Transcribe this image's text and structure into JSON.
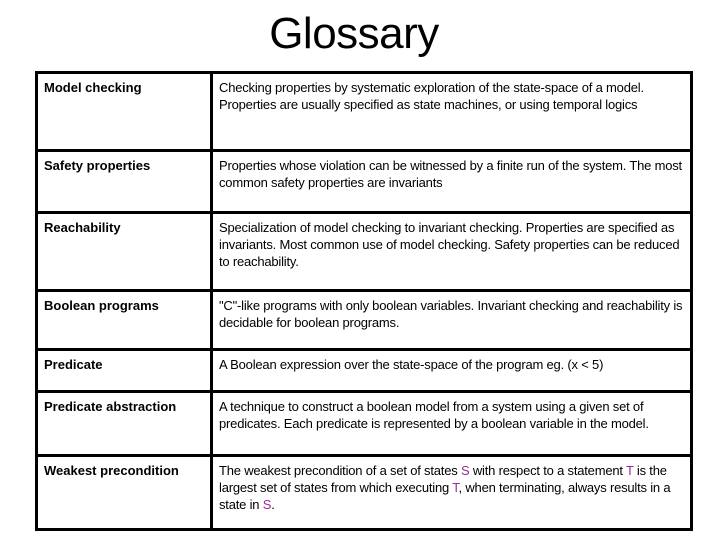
{
  "title": "Glossary",
  "rows": [
    {
      "term": "Model checking",
      "definition": "Checking properties by systematic exploration of the state-space of a model. Properties are usually specified as state machines, or using temporal logics"
    },
    {
      "term": "Safety properties",
      "definition": "Properties whose violation can be witnessed by a finite run of the system. The most common safety properties are invariants"
    },
    {
      "term": "Reachability",
      "definition": "Specialization of model checking to invariant checking. Properties are specified as invariants. Most common use of model checking. Safety properties can be reduced to reachability."
    },
    {
      "term": "Boolean programs",
      "definition": "\"C\"-like programs with only boolean variables. Invariant checking and reachability is decidable for boolean programs."
    },
    {
      "term": "Predicate",
      "definition": "A Boolean expression over the state-space of the program eg. (x < 5)"
    },
    {
      "term": "Predicate abstraction",
      "definition": "A technique to construct a boolean model from a system using a given set of predicates. Each predicate is represented by a boolean variable in the model."
    },
    {
      "term": "Weakest precondition",
      "definition_parts": [
        {
          "text": "The weakest precondition of a set of states "
        },
        {
          "text": "S",
          "highlight": true
        },
        {
          "text": " with respect to a statement "
        },
        {
          "text": "T",
          "highlight": true
        },
        {
          "text": " is the largest set of states from which executing "
        },
        {
          "text": "T",
          "highlight": true
        },
        {
          "text": ", when terminating, always results in a state in "
        },
        {
          "text": "S",
          "highlight": true
        },
        {
          "text": "."
        }
      ]
    }
  ],
  "colors": {
    "highlight": "#9b2d9b",
    "border": "#000000"
  }
}
